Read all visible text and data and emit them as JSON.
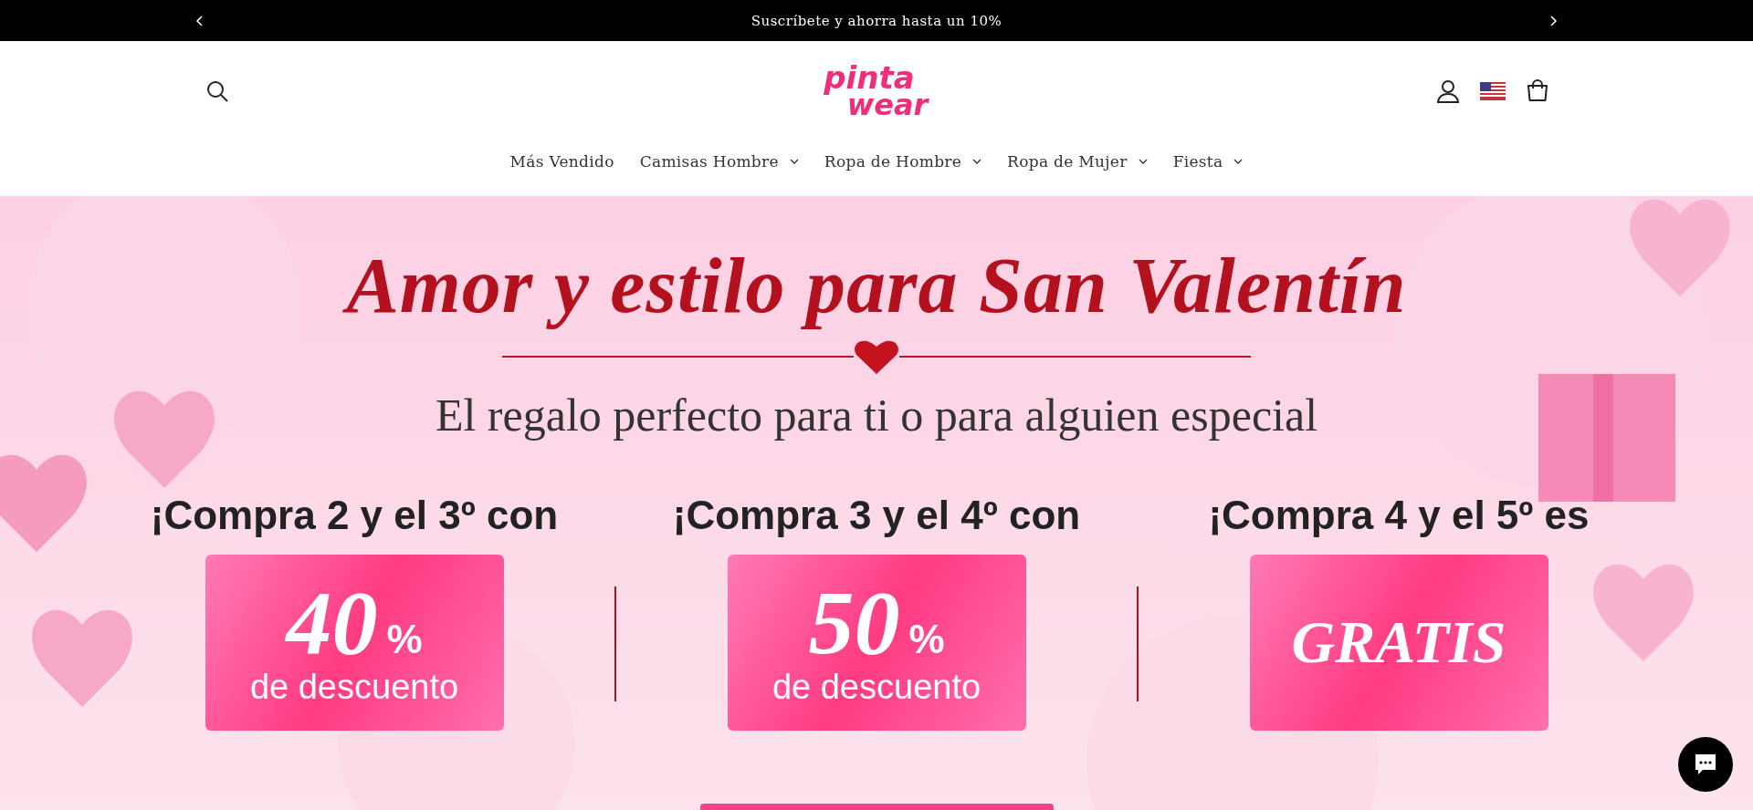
{
  "announcement": {
    "text": "Suscríbete y ahorra hasta un 10%"
  },
  "logo": {
    "line_1": "pinta",
    "line_2": "wear"
  },
  "nav": [
    {
      "label": "Más Vendido",
      "has_dropdown": false
    },
    {
      "label": "Camisas Hombre",
      "has_dropdown": true
    },
    {
      "label": "Ropa de Hombre",
      "has_dropdown": true
    },
    {
      "label": "Ropa de Mujer",
      "has_dropdown": true
    },
    {
      "label": "Fiesta",
      "has_dropdown": true
    }
  ],
  "banner": {
    "title": "Amor y estilo para San Valentín",
    "subtitle": "El regalo perfecto para ti o para alguien especial",
    "offers": [
      {
        "heading": "¡Compra 2 y el 3º con",
        "big": "40",
        "percent": "%",
        "note": "de descuento"
      },
      {
        "heading": "¡Compra 3 y el 4º con",
        "big": "50",
        "percent": "%",
        "note": "de descuento"
      },
      {
        "heading": "¡Compra 4 y el 5º es",
        "big": "GRATIS"
      }
    ]
  }
}
